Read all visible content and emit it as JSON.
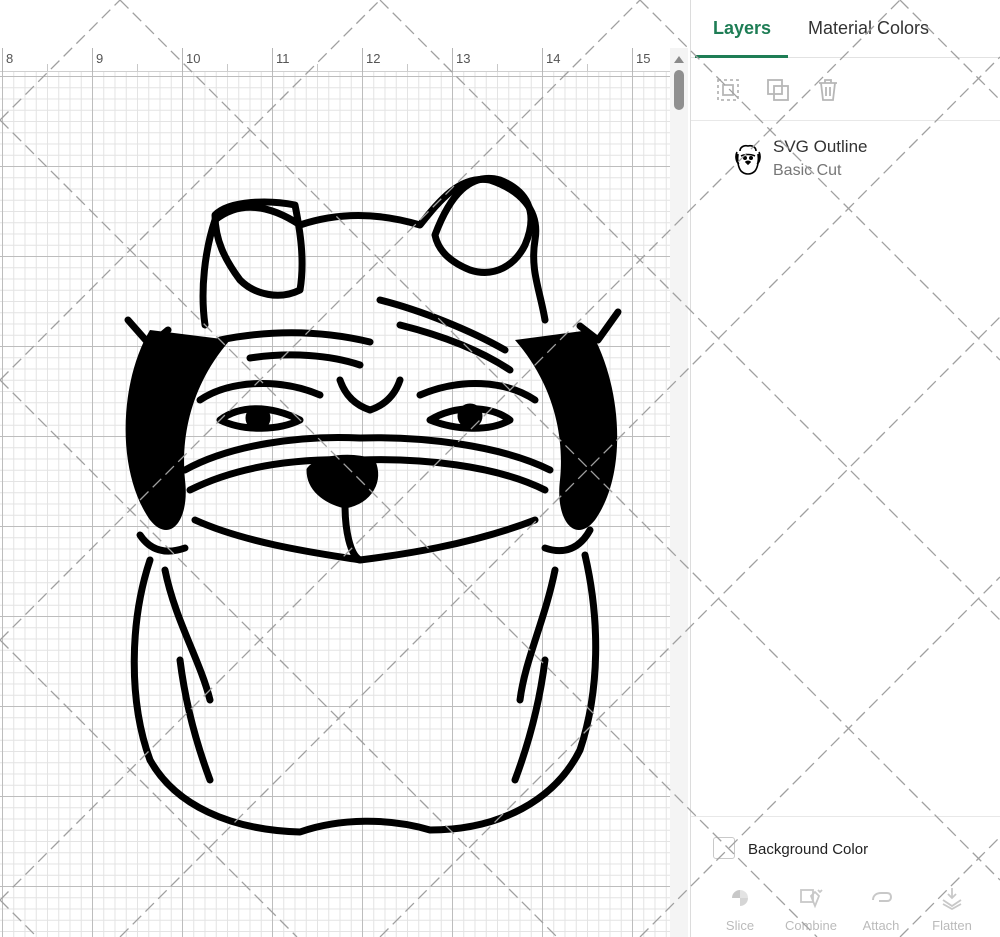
{
  "ruler": {
    "labels": [
      "8",
      "9",
      "10",
      "11",
      "12",
      "13",
      "14",
      "15"
    ]
  },
  "panel": {
    "tabs": [
      {
        "label": "Layers",
        "active": true
      },
      {
        "label": "Material Colors",
        "active": false
      }
    ],
    "toolbar_icons": [
      "group-icon",
      "duplicate-icon",
      "delete-icon"
    ],
    "layer": {
      "name": "SVG Outline",
      "operation": "Basic Cut"
    },
    "background_color": {
      "label": "Background Color",
      "checked": false
    },
    "bottom_tools": [
      {
        "label": "Slice",
        "icon": "slice-icon"
      },
      {
        "label": "Combine",
        "icon": "combine-icon"
      },
      {
        "label": "Attach",
        "icon": "attach-icon"
      },
      {
        "label": "Flatten",
        "icon": "flatten-icon"
      }
    ]
  },
  "colors": {
    "accent": "#1e7d55",
    "artwork": "#000000"
  }
}
